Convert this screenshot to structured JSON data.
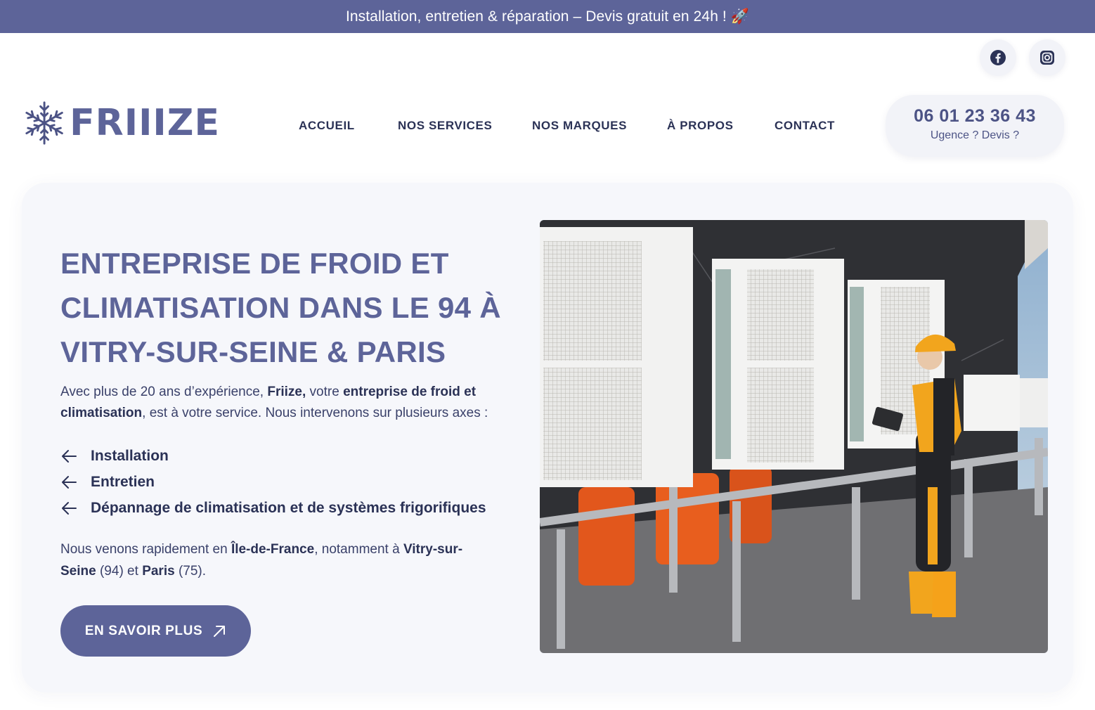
{
  "topbar": {
    "text": "Installation, entretien & réparation – Devis gratuit en 24h ! 🚀"
  },
  "social": {
    "facebook_icon": "facebook-icon",
    "instagram_icon": "instagram-icon"
  },
  "logo": {
    "text": "FRIIIZE",
    "icon": "snowflake-icon"
  },
  "nav": {
    "items": [
      {
        "label": "ACCUEIL"
      },
      {
        "label": "NOS SERVICES"
      },
      {
        "label": "NOS MARQUES"
      },
      {
        "label": "À PROPOS"
      },
      {
        "label": "CONTACT"
      }
    ]
  },
  "phone": {
    "number": "06 01 23 36 43",
    "subtitle": "Ugence ? Devis ?"
  },
  "hero": {
    "title": "ENTREPRISE DE FROID ET CLIMATISATION DANS LE 94 À VITRY-SUR-SEINE & PARIS",
    "intro": {
      "t1": "Avec plus de 20 ans d’expérience, ",
      "b1": "Friize,",
      "t2": " votre ",
      "b2": "entreprise de froid et climatisation",
      "t3": ", est à votre service. Nous intervenons sur plusieurs axes :"
    },
    "bullets": [
      {
        "label": "Installation"
      },
      {
        "label": "Entretien"
      },
      {
        "label": "Dépannage de climatisation et de systèmes frigorifiques"
      }
    ],
    "outro": {
      "t1": "Nous venons rapidement en ",
      "b1": "Île-de-France",
      "t2": ", notamment à ",
      "b2": "Vitry-sur-Seine",
      "t3": " (94) et ",
      "b3": "Paris",
      "t4": " (75)."
    },
    "cta_label": "EN SAVOIR PLUS"
  },
  "colors": {
    "brand": "#5d6499",
    "dark": "#2b3256",
    "card": "#f6f7fb",
    "accent_orange": "#f2a51d"
  }
}
